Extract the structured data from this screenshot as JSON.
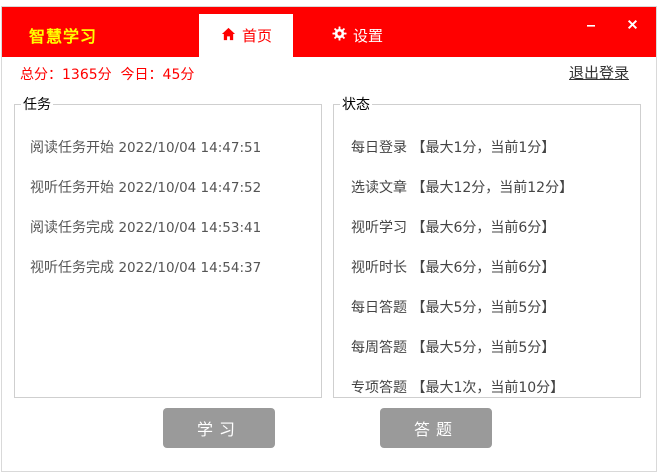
{
  "app": {
    "title": "智慧学习"
  },
  "tabs": [
    {
      "label": "首页",
      "icon": "home-icon"
    },
    {
      "label": "设置",
      "icon": "gear-icon"
    }
  ],
  "window_controls": {
    "minimize": "–",
    "close": "✕"
  },
  "score": {
    "total_label": "总分：",
    "total_value": "1365分",
    "today_label": "今日：",
    "today_value": "45分"
  },
  "logout_label": "退出登录",
  "tasks": {
    "legend": "任务",
    "items": [
      {
        "name": "阅读任务开始",
        "time": "2022/10/04 14:47:51"
      },
      {
        "name": "视听任务开始",
        "time": "2022/10/04 14:47:52"
      },
      {
        "name": "阅读任务完成",
        "time": "2022/10/04 14:53:41"
      },
      {
        "name": "视听任务完成",
        "time": "2022/10/04 14:54:37"
      }
    ]
  },
  "status": {
    "legend": "状态",
    "items": [
      {
        "name": "每日登录",
        "detail": "【最大1分，当前1分】"
      },
      {
        "name": "选读文章",
        "detail": "【最大12分，当前12分】"
      },
      {
        "name": "视听学习",
        "detail": "【最大6分，当前6分】"
      },
      {
        "name": "视听时长",
        "detail": "【最大6分，当前6分】"
      },
      {
        "name": "每日答题",
        "detail": "【最大5分，当前5分】"
      },
      {
        "name": "每周答题",
        "detail": "【最大5分，当前5分】"
      },
      {
        "name": "专项答题",
        "detail": "【最大1次，当前10分】"
      }
    ]
  },
  "buttons": {
    "study": "学习",
    "quiz": "答题"
  },
  "colors": {
    "accent": "#ff0000",
    "title": "#ffff00",
    "button": "#9a9a9a"
  }
}
